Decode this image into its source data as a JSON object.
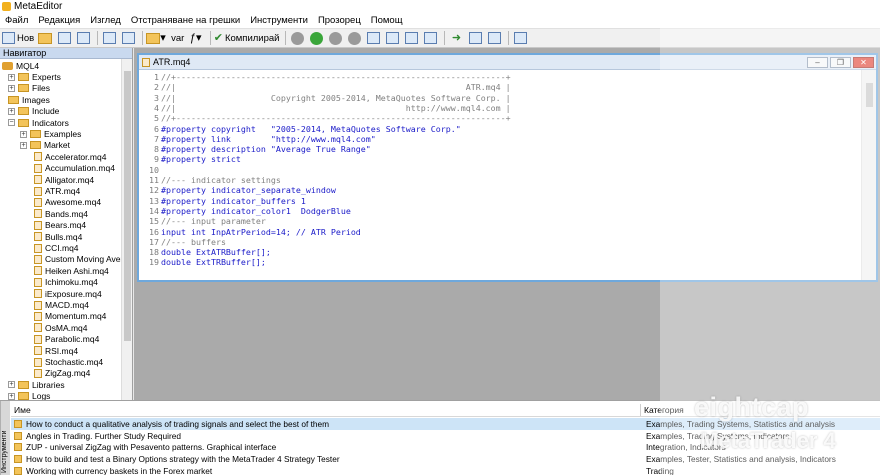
{
  "window": {
    "title": "MetaEditor"
  },
  "menu": [
    "Файл",
    "Редакция",
    "Изглед",
    "Отстраняване на грешки",
    "Инструменти",
    "Прозорец",
    "Помощ"
  ],
  "toolbar": {
    "new_label": "Нов",
    "compile_label": "Компилирай",
    "var_label": "var"
  },
  "navigator": {
    "title": "Навигатор",
    "root": "MQL4",
    "folders": [
      "Experts",
      "Files",
      "Images",
      "Include",
      "Indicators"
    ],
    "indicator_subfolders": [
      "Examples",
      "Market"
    ],
    "indicator_files": [
      "Accelerator.mq4",
      "Accumulation.mq4",
      "Alligator.mq4",
      "ATR.mq4",
      "Awesome.mq4",
      "Bands.mq4",
      "Bears.mq4",
      "Bulls.mq4",
      "CCI.mq4",
      "Custom Moving Avera",
      "Heiken Ashi.mq4",
      "Ichimoku.mq4",
      "iExposure.mq4",
      "MACD.mq4",
      "Momentum.mq4",
      "OsMA.mq4",
      "Parabolic.mq4",
      "RSI.mq4",
      "Stochastic.mq4",
      "ZigZag.mq4"
    ],
    "bottom_folders": [
      "Libraries",
      "Logs"
    ]
  },
  "editor": {
    "title": "ATR.mq4",
    "line_numbers": [
      "1",
      "2",
      "3",
      "4",
      "5",
      "6",
      "7",
      "8",
      "9",
      "10",
      "11",
      "12",
      "13",
      "14",
      "15",
      "16",
      "17",
      "18",
      "19"
    ],
    "lines": [
      "//+------------------------------------------------------------------+",
      "//|                                                          ATR.mq4 |",
      "//|                   Copyright 2005-2014, MetaQuotes Software Corp. |",
      "//|                                              http://www.mql4.com |",
      "//+------------------------------------------------------------------+",
      "#property copyright   \"2005-2014, MetaQuotes Software Corp.\"",
      "#property link        \"http://www.mql4.com\"",
      "#property description \"Average True Range\"",
      "#property strict",
      "",
      "//--- indicator settings",
      "#property indicator_separate_window",
      "#property indicator_buffers 1",
      "#property indicator_color1  DodgerBlue",
      "//--- input parameter",
      "input int InpAtrPeriod=14; // ATR Period",
      "//--- buffers",
      "double ExtATRBuffer[];",
      "double ExtTRBuffer[];"
    ]
  },
  "tools": {
    "side_label": "Инструменти",
    "columns": [
      "Име",
      "Категория"
    ],
    "rows": [
      {
        "name": "How to conduct a qualitative analysis of trading signals and select the best of them",
        "category": "Examples, Trading Systems, Statistics and analysis"
      },
      {
        "name": "Angles in Trading. Further Study Required",
        "category": "Examples, Trading Systems, Indicators"
      },
      {
        "name": "ZUP - universal ZigZag with Pesavento patterns. Graphical interface",
        "category": "Integration, Indicators"
      },
      {
        "name": "How to build and test a Binary Options strategy with the MetaTrader 4 Strategy Tester",
        "category": "Examples, Tester, Statistics and analysis, Indicators"
      },
      {
        "name": "Working with currency baskets in the Forex market",
        "category": "Trading"
      }
    ]
  },
  "watermark": {
    "brand": "eightcap",
    "product": "MetaTrader 4"
  },
  "colors": {
    "accent": "#6ea8dc",
    "workspace": "#aaaaaa"
  }
}
